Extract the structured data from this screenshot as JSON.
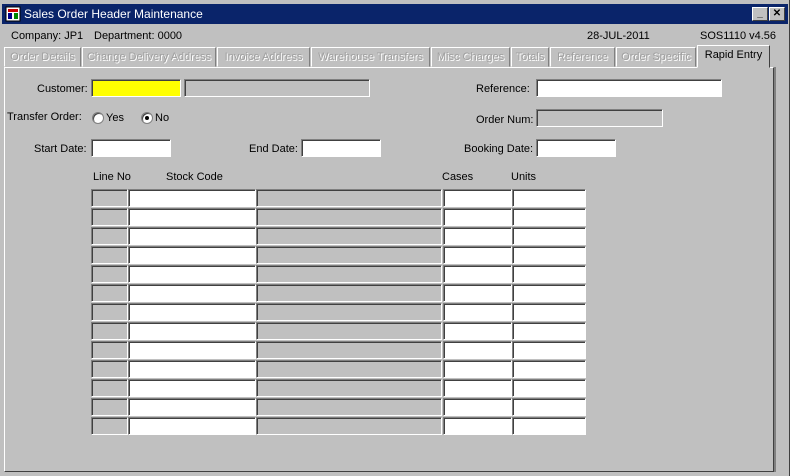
{
  "window": {
    "title": "Sales Order Header Maintenance",
    "minimize": "_",
    "close": "✕"
  },
  "info": {
    "company": "Company:  JP1",
    "department": "Department:  0000",
    "date": "28-JUL-2011",
    "program": "SOS1110  v4.56"
  },
  "tabs": [
    {
      "label": "Order Details"
    },
    {
      "label": "Change Delivery Address"
    },
    {
      "label": "Invoice Address"
    },
    {
      "label": "Warehouse Transfers"
    },
    {
      "label": "Misc Charges"
    },
    {
      "label": "Totals"
    },
    {
      "label": "Reference"
    },
    {
      "label": "Order Specific"
    },
    {
      "label": "Rapid Entry"
    }
  ],
  "form": {
    "customer_label": "Customer:",
    "reference_label": "Reference:",
    "transfer_label": "Transfer Order:",
    "yes_label": "Yes",
    "no_label": "No",
    "transfer_value": "No",
    "ordernum_label": "Order Num:",
    "startdate_label": "Start Date:",
    "enddate_label": "End Date:",
    "bookingdate_label": "Booking Date:"
  },
  "grid": {
    "headers": {
      "line_no": "Line No",
      "stock_code": "Stock Code",
      "cases": "Cases",
      "units": "Units"
    },
    "row_count": 13
  }
}
